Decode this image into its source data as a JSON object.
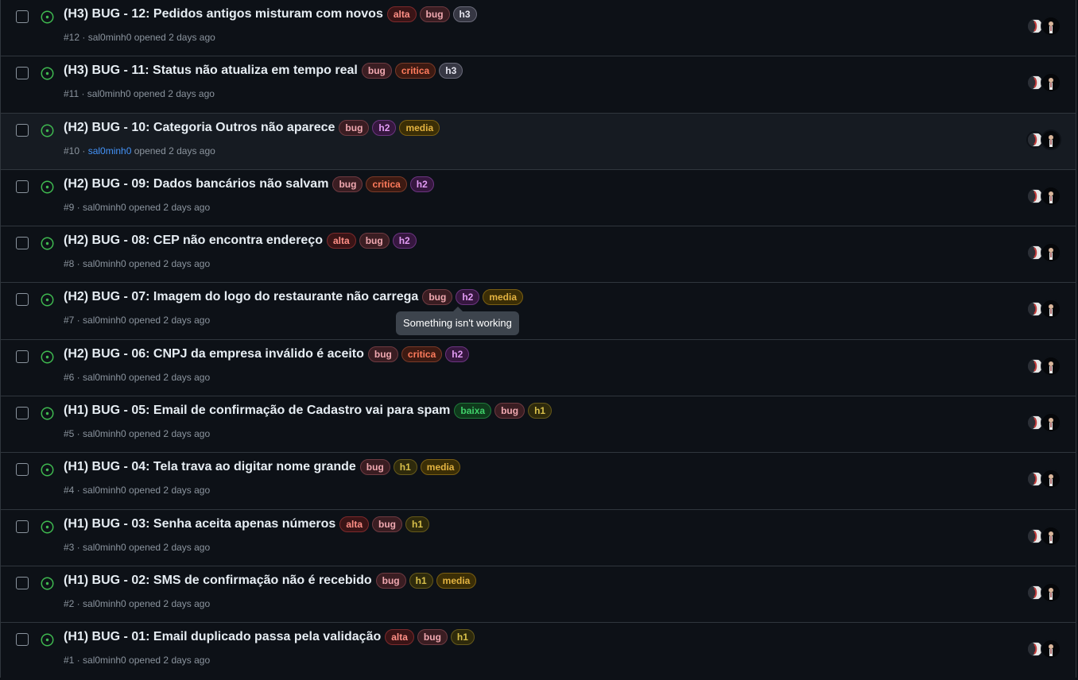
{
  "labels_style": {
    "alta": {
      "fg": "#ff8f86",
      "bg": "#3a1416",
      "border": "#7d2a2c"
    },
    "bug": {
      "fg": "#f0a8b0",
      "bg": "#3a1d22",
      "border": "#6e3a41"
    },
    "h3": {
      "fg": "#e6e6f0",
      "bg": "#363743",
      "border": "#6a6b7a"
    },
    "critica": {
      "fg": "#ff7b5c",
      "bg": "#3d1a12",
      "border": "#7a3a28"
    },
    "h2": {
      "fg": "#e39cf5",
      "bg": "#36173f",
      "border": "#6b3480"
    },
    "media": {
      "fg": "#e3b341",
      "bg": "#3b2e06",
      "border": "#7a5e12"
    },
    "baixa": {
      "fg": "#3fd16a",
      "bg": "#0f3a1c",
      "border": "#1f7a3a"
    },
    "h1": {
      "fg": "#d8c04a",
      "bg": "#2e2a0c",
      "border": "#66591a"
    }
  },
  "issues": [
    {
      "title": "(H3) BUG - 12: Pedidos antigos misturam com novos",
      "labels": [
        "alta",
        "bug",
        "h3"
      ],
      "meta_prefix": "#12 · ",
      "author": "sal0minh0",
      "meta_suffix": " opened 2 days ago"
    },
    {
      "title": "(H3) BUG - 11: Status não atualiza em tempo real",
      "labels": [
        "bug",
        "critica",
        "h3"
      ],
      "meta_prefix": "#11 · ",
      "author": "sal0minh0",
      "meta_suffix": " opened 2 days ago"
    },
    {
      "title": "(H2) BUG - 10: Categoria Outros não aparece",
      "labels": [
        "bug",
        "h2",
        "media"
      ],
      "meta_prefix": "#10 · ",
      "author": "sal0minh0",
      "meta_suffix": " opened 2 days ago"
    },
    {
      "title": "(H2) BUG - 09: Dados bancários não salvam",
      "labels": [
        "bug",
        "critica",
        "h2"
      ],
      "meta_prefix": "#9 · ",
      "author": "sal0minh0",
      "meta_suffix": " opened 2 days ago"
    },
    {
      "title": "(H2) BUG - 08: CEP não encontra endereço",
      "labels": [
        "alta",
        "bug",
        "h2"
      ],
      "meta_prefix": "#8 · ",
      "author": "sal0minh0",
      "meta_suffix": " opened 2 days ago"
    },
    {
      "title": "(H2) BUG - 07: Imagem do logo do restaurante não carrega",
      "labels": [
        "bug",
        "h2",
        "media"
      ],
      "meta_prefix": "#7 · ",
      "author": "sal0minh0",
      "meta_suffix": " opened 2 days ago"
    },
    {
      "title": "(H2) BUG - 06: CNPJ da empresa inválido é aceito",
      "labels": [
        "bug",
        "critica",
        "h2"
      ],
      "meta_prefix": "#6 · ",
      "author": "sal0minh0",
      "meta_suffix": " opened 2 days ago"
    },
    {
      "title": "(H1) BUG - 05: Email de confirmação de Cadastro vai para spam",
      "labels": [
        "baixa",
        "bug",
        "h1"
      ],
      "meta_prefix": "#5 · ",
      "author": "sal0minh0",
      "meta_suffix": " opened 2 days ago"
    },
    {
      "title": "(H1) BUG - 04: Tela trava ao digitar nome grande",
      "labels": [
        "bug",
        "h1",
        "media"
      ],
      "meta_prefix": "#4 · ",
      "author": "sal0minh0",
      "meta_suffix": " opened 2 days ago"
    },
    {
      "title": "(H1) BUG - 03: Senha aceita apenas números",
      "labels": [
        "alta",
        "bug",
        "h1"
      ],
      "meta_prefix": "#3 · ",
      "author": "sal0minh0",
      "meta_suffix": " opened 2 days ago"
    },
    {
      "title": "(H1) BUG - 02: SMS de confirmação não é recebido",
      "labels": [
        "bug",
        "h1",
        "media"
      ],
      "meta_prefix": "#2 · ",
      "author": "sal0minh0",
      "meta_suffix": " opened 2 days ago"
    },
    {
      "title": "(H1) BUG - 01: Email duplicado passa pela validação",
      "labels": [
        "alta",
        "bug",
        "h1"
      ],
      "meta_prefix": "#1 · ",
      "author": "sal0minh0",
      "meta_suffix": " opened 2 days ago"
    }
  ],
  "hovered_index": 2,
  "tooltip": {
    "text": "Something isn't working"
  },
  "icons": {
    "state": "issue-opened-icon",
    "checkbox": "checkbox-icon",
    "avatar": "avatar"
  },
  "colors": {
    "open_green": "#3fb950",
    "link_blue": "#4493f8"
  }
}
